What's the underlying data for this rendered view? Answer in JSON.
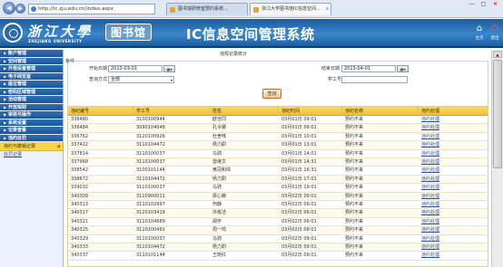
{
  "browser": {
    "url": "http://ic.zju.edu.cn/index.aspx",
    "tabs": [
      {
        "label": "图书馆研修室预约系统..."
      },
      {
        "label": "浙江大学图书馆IC信息空间..."
      }
    ],
    "back_glyph": "◀",
    "fwd_glyph": "▶",
    "min_glyph": "—",
    "max_glyph": "□",
    "close_glyph": "✕",
    "tab_close_glyph": "x"
  },
  "header": {
    "university_cn": "浙江大學",
    "university_en": "ZHEJIANG UNIVERSITY",
    "library": "图书馆",
    "title": "IC信息空间管理系统",
    "home_label": "主页",
    "exit_label": "退出",
    "home_glyph": "⌂",
    "exit_glyph": "⏻"
  },
  "sidebar": {
    "items": [
      {
        "label": "账户管理"
      },
      {
        "label": "空间管理"
      },
      {
        "label": "外借设备管理"
      },
      {
        "label": "电子阅览室"
      },
      {
        "label": "座位管理"
      },
      {
        "label": "密码区域管理"
      },
      {
        "label": "活动管理"
      },
      {
        "label": "开放规则"
      },
      {
        "label": "审核与操作"
      },
      {
        "label": "系统设置"
      },
      {
        "label": "记录查看"
      },
      {
        "label": "违约处罚"
      }
    ],
    "arrow_glyph": "▶",
    "active_sub": "违约与撤销记录",
    "active_arrow": "◀",
    "sub_link": "处罚记录"
  },
  "form": {
    "panel_title": "违规记录统计",
    "legend": "条件",
    "start_label": "开始日期",
    "start_value": "2013-03-01",
    "end_label": "结束日期",
    "end_value": "2013-04-01",
    "query_type_label": "查询方式",
    "query_type_value": "全部",
    "student_id_label": "学工号",
    "student_id_value": "",
    "query_button": "查询",
    "calendar_glyph": "▦▾",
    "caret_glyph": "▾"
  },
  "table": {
    "headers": [
      "违纪编号",
      "学工号",
      "姓名",
      "违纪时间",
      "违纪名称",
      "违约处理"
    ],
    "rows": [
      [
        "336480",
        "3100100944",
        "欧佳同",
        "03月01日 09:01",
        "预约不来",
        "违约处理"
      ],
      [
        "336484",
        "3090104048",
        "孔令娜",
        "03月01日 09:01",
        "预约不来",
        "违约处理"
      ],
      [
        "336762",
        "3120100926",
        "杜舍咪",
        "03月01日 10:01",
        "预约不来",
        "违约处理"
      ],
      [
        "337422",
        "3110104472",
        "杨力尉",
        "03月01日 13:01",
        "预约不来",
        "违约处理"
      ],
      [
        "337814",
        "3110100037",
        "马骋",
        "03月01日 14:01",
        "预约不来",
        "违约处理"
      ],
      [
        "337968",
        "3110100037",
        "雷继文",
        "03月01日 14:31",
        "预约不来",
        "违约处理"
      ],
      [
        "338542",
        "3100101144",
        "黄冠和情",
        "03月01日 16:31",
        "预约不来",
        "违约处理"
      ],
      [
        "338672",
        "3110104472",
        "杨力尉",
        "03月01日 17:01",
        "预约不来",
        "违约处理"
      ],
      [
        "339032",
        "3110100037",
        "马骋",
        "03月01日 19:01",
        "预约不来",
        "违约处理"
      ],
      [
        "340309",
        "3110900011",
        "梁心薇",
        "03月02日 09:01",
        "预约不来",
        "违约处理"
      ],
      [
        "340313",
        "3110102997",
        "何静",
        "03月02日 09:01",
        "预约不来",
        "违约处理"
      ],
      [
        "340317",
        "3120103419",
        "许栋洁",
        "03月02日 09:01",
        "预约不来",
        "违约处理"
      ],
      [
        "340321",
        "3110104689",
        "胡宇",
        "03月02日 09:01",
        "预约不来",
        "违约处理"
      ],
      [
        "340325",
        "3110100491",
        "周一鸣",
        "03月02日 09:01",
        "预约不来",
        "违约处理"
      ],
      [
        "340329",
        "3110100037",
        "马骋",
        "03月02日 09:01",
        "预约不来",
        "违约处理"
      ],
      [
        "340333",
        "3110104472",
        "杨力尉",
        "03月02日 09:01",
        "预约不来",
        "违约处理"
      ],
      [
        "340337",
        "3110101144",
        "王晓红",
        "03月02日 09:01",
        "预约不来",
        "违约处理"
      ]
    ]
  },
  "scrollbar": {
    "up_glyph": "▲"
  }
}
